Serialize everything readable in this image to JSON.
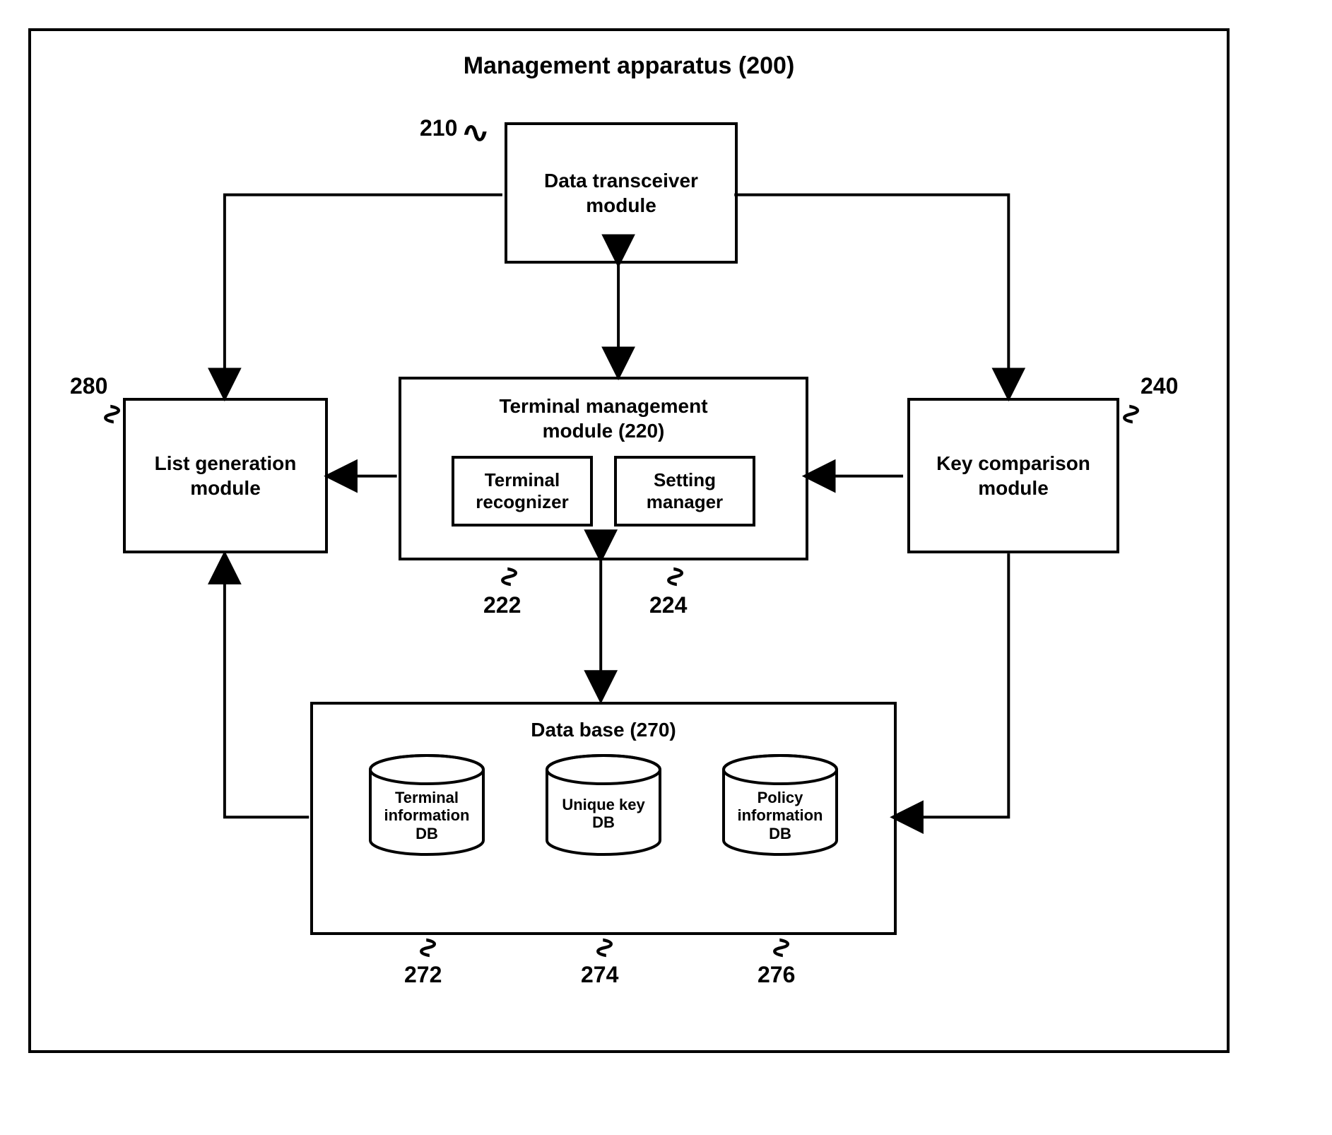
{
  "title": "Management apparatus (200)",
  "blocks": {
    "data_transceiver": {
      "label": "Data transceiver\nmodule",
      "ref": "210"
    },
    "terminal_mgmt": {
      "label": "Terminal management\nmodule (220)",
      "sub": {
        "recognizer": {
          "label": "Terminal\nrecognizer",
          "ref": "222"
        },
        "setting_mgr": {
          "label": "Setting\nmanager",
          "ref": "224"
        }
      }
    },
    "list_gen": {
      "label": "List generation\nmodule",
      "ref": "280"
    },
    "key_cmp": {
      "label": "Key comparison\nmodule",
      "ref": "240"
    },
    "database": {
      "label": "Data base (270)",
      "db": {
        "terminal": {
          "label": "Terminal\ninformation\nDB",
          "ref": "272"
        },
        "unique": {
          "label": "Unique key\nDB",
          "ref": "274"
        },
        "policy": {
          "label": "Policy\ninformation\nDB",
          "ref": "276"
        }
      }
    }
  }
}
